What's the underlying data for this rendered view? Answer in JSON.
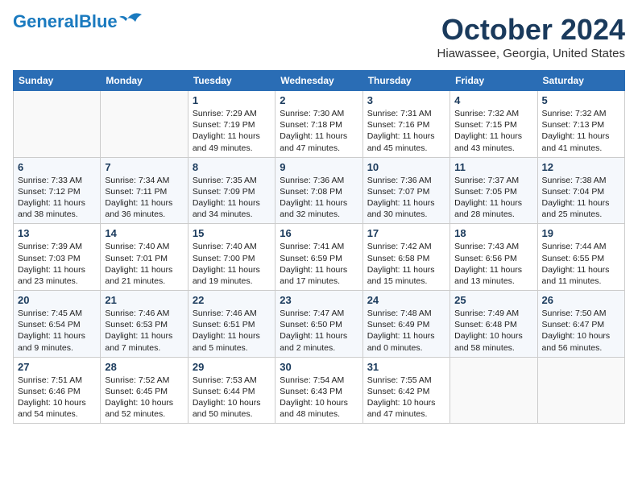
{
  "header": {
    "logo_line1": "General",
    "logo_line2": "Blue",
    "title": "October 2024",
    "subtitle": "Hiawassee, Georgia, United States"
  },
  "weekdays": [
    "Sunday",
    "Monday",
    "Tuesday",
    "Wednesday",
    "Thursday",
    "Friday",
    "Saturday"
  ],
  "weeks": [
    [
      {
        "day": "",
        "info": ""
      },
      {
        "day": "",
        "info": ""
      },
      {
        "day": "1",
        "info": "Sunrise: 7:29 AM\nSunset: 7:19 PM\nDaylight: 11 hours and 49 minutes."
      },
      {
        "day": "2",
        "info": "Sunrise: 7:30 AM\nSunset: 7:18 PM\nDaylight: 11 hours and 47 minutes."
      },
      {
        "day": "3",
        "info": "Sunrise: 7:31 AM\nSunset: 7:16 PM\nDaylight: 11 hours and 45 minutes."
      },
      {
        "day": "4",
        "info": "Sunrise: 7:32 AM\nSunset: 7:15 PM\nDaylight: 11 hours and 43 minutes."
      },
      {
        "day": "5",
        "info": "Sunrise: 7:32 AM\nSunset: 7:13 PM\nDaylight: 11 hours and 41 minutes."
      }
    ],
    [
      {
        "day": "6",
        "info": "Sunrise: 7:33 AM\nSunset: 7:12 PM\nDaylight: 11 hours and 38 minutes."
      },
      {
        "day": "7",
        "info": "Sunrise: 7:34 AM\nSunset: 7:11 PM\nDaylight: 11 hours and 36 minutes."
      },
      {
        "day": "8",
        "info": "Sunrise: 7:35 AM\nSunset: 7:09 PM\nDaylight: 11 hours and 34 minutes."
      },
      {
        "day": "9",
        "info": "Sunrise: 7:36 AM\nSunset: 7:08 PM\nDaylight: 11 hours and 32 minutes."
      },
      {
        "day": "10",
        "info": "Sunrise: 7:36 AM\nSunset: 7:07 PM\nDaylight: 11 hours and 30 minutes."
      },
      {
        "day": "11",
        "info": "Sunrise: 7:37 AM\nSunset: 7:05 PM\nDaylight: 11 hours and 28 minutes."
      },
      {
        "day": "12",
        "info": "Sunrise: 7:38 AM\nSunset: 7:04 PM\nDaylight: 11 hours and 25 minutes."
      }
    ],
    [
      {
        "day": "13",
        "info": "Sunrise: 7:39 AM\nSunset: 7:03 PM\nDaylight: 11 hours and 23 minutes."
      },
      {
        "day": "14",
        "info": "Sunrise: 7:40 AM\nSunset: 7:01 PM\nDaylight: 11 hours and 21 minutes."
      },
      {
        "day": "15",
        "info": "Sunrise: 7:40 AM\nSunset: 7:00 PM\nDaylight: 11 hours and 19 minutes."
      },
      {
        "day": "16",
        "info": "Sunrise: 7:41 AM\nSunset: 6:59 PM\nDaylight: 11 hours and 17 minutes."
      },
      {
        "day": "17",
        "info": "Sunrise: 7:42 AM\nSunset: 6:58 PM\nDaylight: 11 hours and 15 minutes."
      },
      {
        "day": "18",
        "info": "Sunrise: 7:43 AM\nSunset: 6:56 PM\nDaylight: 11 hours and 13 minutes."
      },
      {
        "day": "19",
        "info": "Sunrise: 7:44 AM\nSunset: 6:55 PM\nDaylight: 11 hours and 11 minutes."
      }
    ],
    [
      {
        "day": "20",
        "info": "Sunrise: 7:45 AM\nSunset: 6:54 PM\nDaylight: 11 hours and 9 minutes."
      },
      {
        "day": "21",
        "info": "Sunrise: 7:46 AM\nSunset: 6:53 PM\nDaylight: 11 hours and 7 minutes."
      },
      {
        "day": "22",
        "info": "Sunrise: 7:46 AM\nSunset: 6:51 PM\nDaylight: 11 hours and 5 minutes."
      },
      {
        "day": "23",
        "info": "Sunrise: 7:47 AM\nSunset: 6:50 PM\nDaylight: 11 hours and 2 minutes."
      },
      {
        "day": "24",
        "info": "Sunrise: 7:48 AM\nSunset: 6:49 PM\nDaylight: 11 hours and 0 minutes."
      },
      {
        "day": "25",
        "info": "Sunrise: 7:49 AM\nSunset: 6:48 PM\nDaylight: 10 hours and 58 minutes."
      },
      {
        "day": "26",
        "info": "Sunrise: 7:50 AM\nSunset: 6:47 PM\nDaylight: 10 hours and 56 minutes."
      }
    ],
    [
      {
        "day": "27",
        "info": "Sunrise: 7:51 AM\nSunset: 6:46 PM\nDaylight: 10 hours and 54 minutes."
      },
      {
        "day": "28",
        "info": "Sunrise: 7:52 AM\nSunset: 6:45 PM\nDaylight: 10 hours and 52 minutes."
      },
      {
        "day": "29",
        "info": "Sunrise: 7:53 AM\nSunset: 6:44 PM\nDaylight: 10 hours and 50 minutes."
      },
      {
        "day": "30",
        "info": "Sunrise: 7:54 AM\nSunset: 6:43 PM\nDaylight: 10 hours and 48 minutes."
      },
      {
        "day": "31",
        "info": "Sunrise: 7:55 AM\nSunset: 6:42 PM\nDaylight: 10 hours and 47 minutes."
      },
      {
        "day": "",
        "info": ""
      },
      {
        "day": "",
        "info": ""
      }
    ]
  ]
}
